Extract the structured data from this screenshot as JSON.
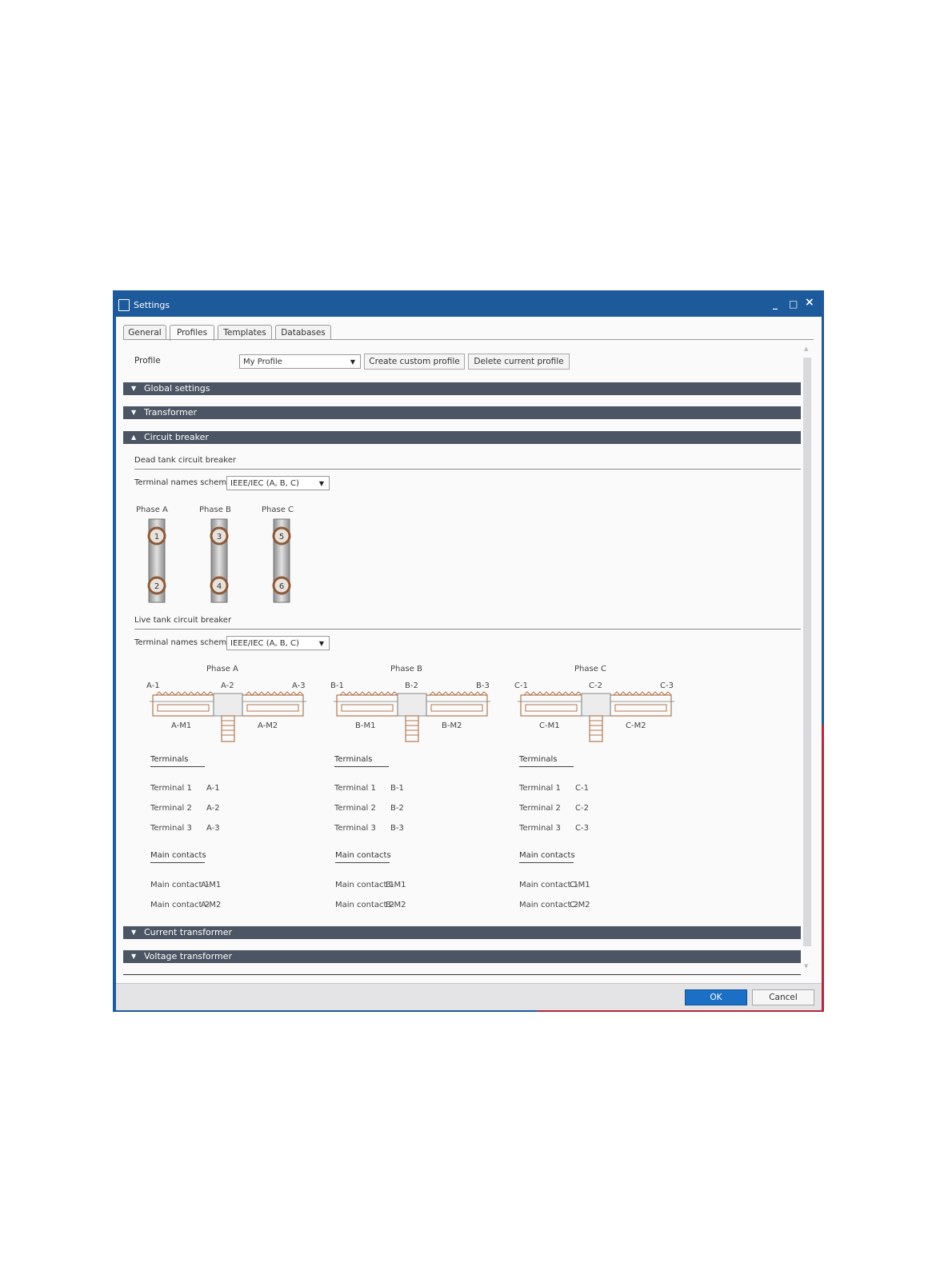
{
  "window": {
    "title": "Settings",
    "controls": {
      "minimize": "_",
      "maximize": "□",
      "close": "×"
    }
  },
  "tabs": [
    {
      "label": "General",
      "active": false
    },
    {
      "label": "Profiles",
      "active": true
    },
    {
      "label": "Templates",
      "active": false
    },
    {
      "label": "Databases",
      "active": false
    }
  ],
  "profile": {
    "label": "Profile",
    "value": "My Profile",
    "create_button": "Create custom profile",
    "delete_button": "Delete current profile"
  },
  "sections": {
    "global": {
      "label": "Global settings",
      "expanded": false
    },
    "transformer": {
      "label": "Transformer",
      "expanded": false
    },
    "circuit_breaker": {
      "label": "Circuit breaker",
      "expanded": true
    },
    "current_transformer": {
      "label": "Current transformer",
      "expanded": false
    },
    "voltage_transformer": {
      "label": "Voltage transformer",
      "expanded": false
    }
  },
  "dead_tank": {
    "heading": "Dead tank circuit breaker",
    "scheme_label": "Terminal names scheme",
    "scheme_value": "IEEE/IEC (A, B, C)",
    "phases": [
      {
        "label": "Phase A",
        "top": "1",
        "bottom": "2"
      },
      {
        "label": "Phase B",
        "top": "3",
        "bottom": "4"
      },
      {
        "label": "Phase C",
        "top": "5",
        "bottom": "6"
      }
    ]
  },
  "live_tank": {
    "heading": "Live tank circuit breaker",
    "scheme_label": "Terminal names scheme",
    "scheme_value": "IEEE/IEC (A, B, C)",
    "phases": [
      {
        "label": "Phase A",
        "t1": "A-1",
        "t2": "A-2",
        "t3": "A-3",
        "m1": "A-M1",
        "m2": "A-M2"
      },
      {
        "label": "Phase B",
        "t1": "B-1",
        "t2": "B-2",
        "t3": "B-3",
        "m1": "B-M1",
        "m2": "B-M2"
      },
      {
        "label": "Phase C",
        "t1": "C-1",
        "t2": "C-2",
        "t3": "C-3",
        "m1": "C-M1",
        "m2": "C-M2"
      }
    ],
    "terminals_heading": "Terminals",
    "contacts_heading": "Main contacts",
    "columns": [
      {
        "terminals": [
          {
            "name": "Terminal 1",
            "value": "A-1"
          },
          {
            "name": "Terminal 2",
            "value": "A-2"
          },
          {
            "name": "Terminal 3",
            "value": "A-3"
          }
        ],
        "contacts": [
          {
            "name": "Main contact 1",
            "value": "A-M1"
          },
          {
            "name": "Main contact 2",
            "value": "A-M2"
          }
        ]
      },
      {
        "terminals": [
          {
            "name": "Terminal 1",
            "value": "B-1"
          },
          {
            "name": "Terminal 2",
            "value": "B-2"
          },
          {
            "name": "Terminal 3",
            "value": "B-3"
          }
        ],
        "contacts": [
          {
            "name": "Main contact 1",
            "value": "B-M1"
          },
          {
            "name": "Main contact 2",
            "value": "B-M2"
          }
        ]
      },
      {
        "terminals": [
          {
            "name": "Terminal 1",
            "value": "C-1"
          },
          {
            "name": "Terminal 2",
            "value": "C-2"
          },
          {
            "name": "Terminal 3",
            "value": "C-3"
          }
        ],
        "contacts": [
          {
            "name": "Main contact 1",
            "value": "C-M1"
          },
          {
            "name": "Main contact 2",
            "value": "C-M2"
          }
        ]
      }
    ]
  },
  "footer": {
    "ok": "OK",
    "cancel": "Cancel"
  },
  "colors": {
    "titlebar": "#1d5a9c",
    "accent_red": "#b5273f",
    "section_bar": "#4b5563",
    "ok_button": "#1b6fc4",
    "terminal_ring": "#8a5a3a"
  }
}
